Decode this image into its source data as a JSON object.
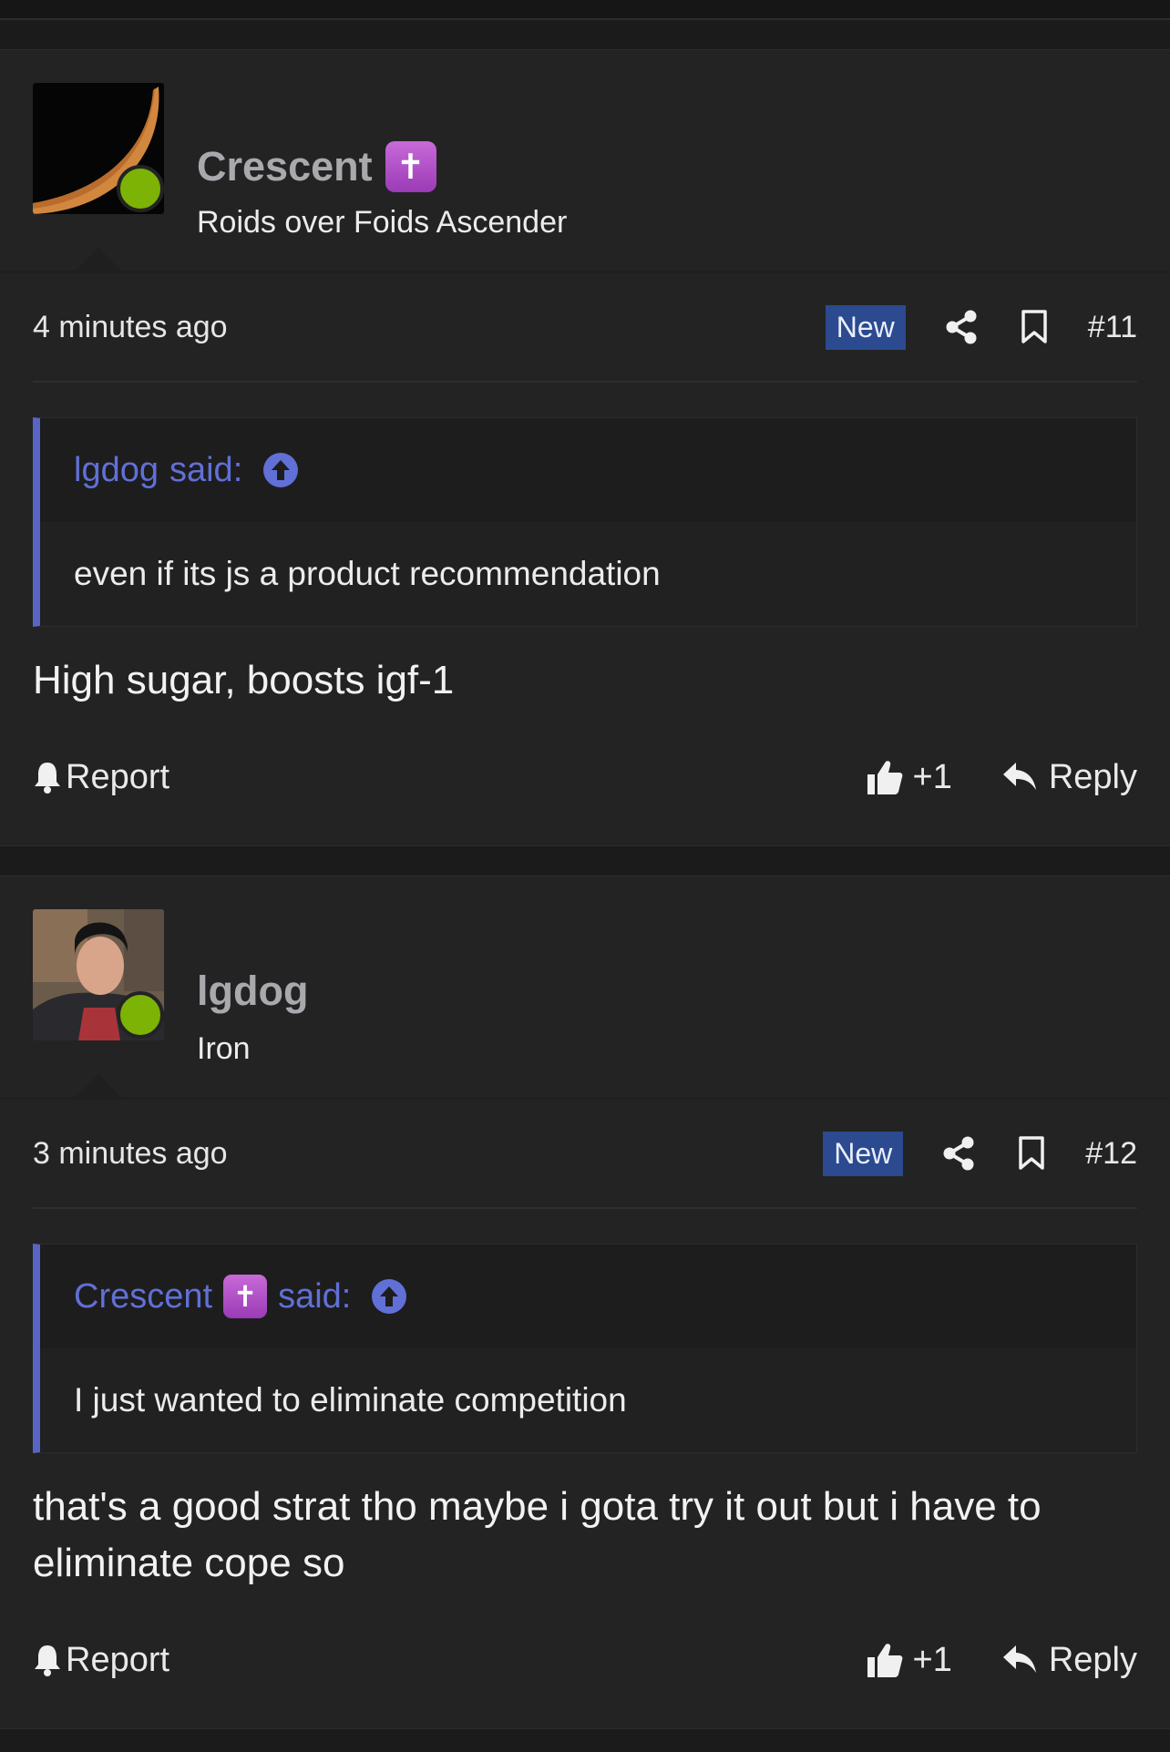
{
  "posts": [
    {
      "username": "Crescent",
      "has_badge": true,
      "badge_glyph": "✝",
      "user_title": "Roids over Foids Ascender",
      "time": "4 minutes ago",
      "new_label": "New",
      "post_number": "#11",
      "quote_author": "lgdog",
      "quote_said": "said:",
      "quote_text": "even if its js a product recommendation",
      "message": "High sugar, boosts igf-1",
      "report_label": "Report",
      "like_count": "+1",
      "reply_label": "Reply"
    },
    {
      "username": "lgdog",
      "has_badge": false,
      "user_title": "Iron",
      "time": "3 minutes ago",
      "new_label": "New",
      "post_number": "#12",
      "quote_author": "Crescent",
      "quote_badge_glyph": "✝",
      "quote_said": "said:",
      "quote_text": "I just wanted to eliminate competition",
      "message": "that's a good strat tho maybe i gota try it out but i have to eliminate cope so",
      "report_label": "Report",
      "like_count": "+1",
      "reply_label": "Reply"
    }
  ],
  "colors": {
    "background": "#1b1b1c",
    "post_background": "#232324",
    "accent_blue": "#6170d6",
    "new_badge": "#2b4a8f",
    "online_green": "#7cb305",
    "badge_purple": "#b04fc9"
  }
}
